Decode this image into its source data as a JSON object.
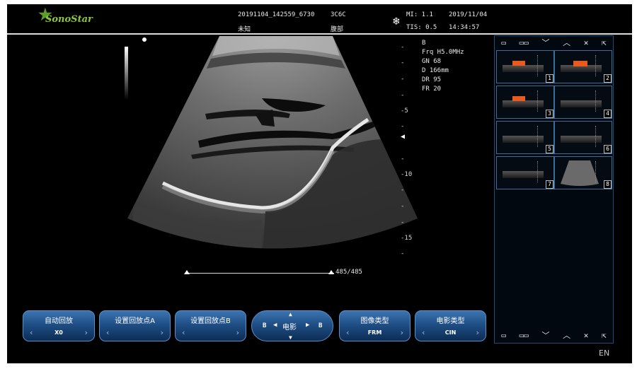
{
  "header": {
    "logo": "SonoStar",
    "exam_id": "20191104_142559_6730",
    "probe": "3C6C",
    "patient": "未知",
    "region": "腹部",
    "mi": "MI: 1.1",
    "tis": "TIS: 0.5",
    "date": "2019/11/04",
    "time": "14:34:57",
    "freeze_icon": "snowflake-icon"
  },
  "params": {
    "mode": "B",
    "frq": "Frq H5.0MHz",
    "gn": "GN  68",
    "d": "D   166mm",
    "dr": "DR  95",
    "fr": "FR  20"
  },
  "depth_scale": {
    "labels": [
      "-5",
      "-10",
      "-15"
    ],
    "marker_icon": "focus-marker-icon"
  },
  "cine": {
    "position": "485/485",
    "fraction": 1.0
  },
  "thumbnails": {
    "toolbar_icons": [
      "single-view-icon",
      "dual-view-icon",
      "chevron-down-icon",
      "chevron-up-icon",
      "close-icon",
      "export-icon"
    ],
    "items": [
      {
        "num": "1",
        "color": true
      },
      {
        "num": "2",
        "color": true
      },
      {
        "num": "3",
        "color": true
      },
      {
        "num": "4",
        "color": false
      },
      {
        "num": "5",
        "color": false
      },
      {
        "num": "6",
        "color": false
      },
      {
        "num": "7",
        "color": false
      },
      {
        "num": "8",
        "color": false
      }
    ]
  },
  "controls": [
    {
      "label": "自动回放",
      "value": "X0"
    },
    {
      "label": "设置回放点A",
      "value": ""
    },
    {
      "label": "设置回放点B",
      "value": ""
    },
    {
      "label": "电影",
      "left": "B",
      "right": "B"
    },
    {
      "label": "图像类型",
      "value": "FRM"
    },
    {
      "label": "电影类型",
      "value": "CIN"
    }
  ],
  "language": "EN",
  "colors": {
    "accent_blue": "#1f4f86",
    "flow_red": "#e85a1e",
    "logo_green": "#8ec63f"
  }
}
